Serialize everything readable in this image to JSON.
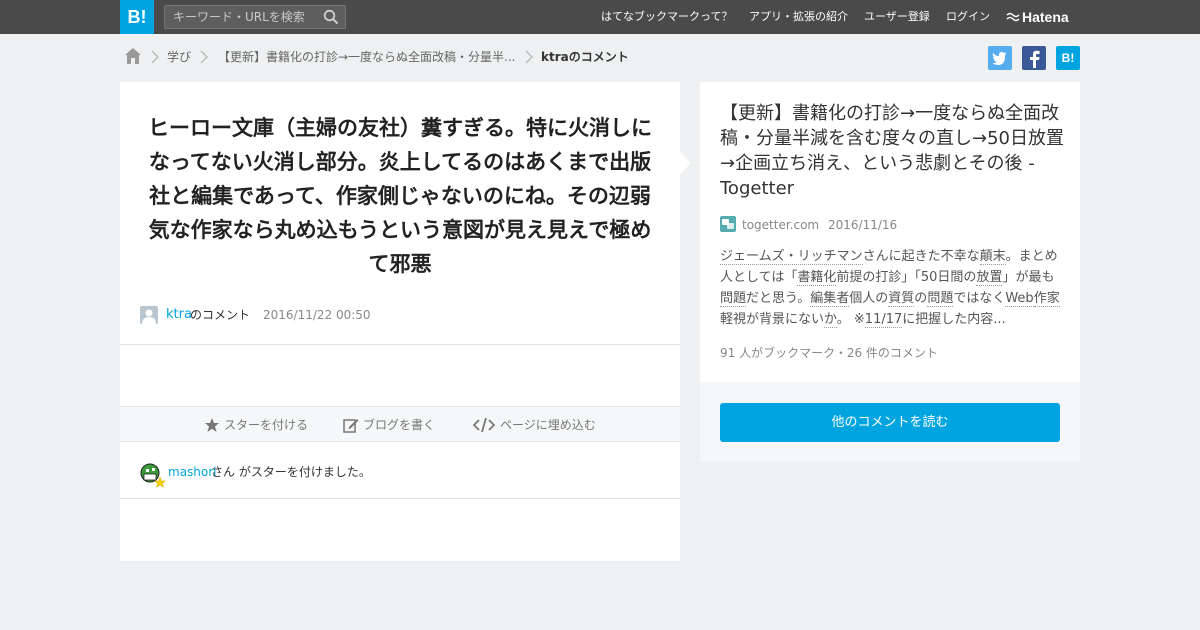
{
  "header": {
    "logo": "B!",
    "search_placeholder": "キーワード・URLを検索",
    "nav": [
      "はてなブックマークって？",
      "アプリ・拡張の紹介",
      "ユーザー登録",
      "ログイン"
    ],
    "brand": "Hatena"
  },
  "breadcrumb": {
    "items": [
      "学び",
      "【更新】書籍化の打診→一度ならぬ全面改稿・分量半...",
      "ktraのコメント"
    ]
  },
  "share": {
    "twitter_icon": "twitter-icon",
    "facebook_icon": "facebook-icon",
    "hatena_label": "B!"
  },
  "comment": {
    "text": "ヒーロー文庫（主婦の友社）糞すぎる。特に火消しになってない火消し部分。炎上してるのはあくまで出版社と編集であって、作家側じゃないのにね。その辺弱気な作家なら丸め込もうという意図が見え見えで極めて邪悪",
    "user": "ktra",
    "user_suffix": "のコメント",
    "date": "2016/11/22 00:50"
  },
  "actions": {
    "star": "スターを付ける",
    "blog": "ブログを書く",
    "embed": "ページに埋め込む"
  },
  "star_notice": {
    "user": "mashori",
    "text": "さん がスターを付けました。"
  },
  "entry": {
    "title": "【更新】書籍化の打診→一度ならぬ全面改稿・分量半減を含む度々の直し→50日放置→企画立ち消え、という悲劇とその後 - Togetter",
    "domain": "togetter.com",
    "date": "2016/11/16",
    "summary_parts": [
      {
        "t": "ジェームズ・リッチマン",
        "kw": true
      },
      {
        "t": "さんに起きた不幸な",
        "kw": false
      },
      {
        "t": "顛末",
        "kw": true
      },
      {
        "t": "。まとめ人としては「",
        "kw": false
      },
      {
        "t": "書籍化",
        "kw": true
      },
      {
        "t": "前提の打診",
        "kw": false
      },
      {
        "t": "」「50日間の",
        "kw": false
      },
      {
        "t": "放置",
        "kw": true
      },
      {
        "t": "」が最も",
        "kw": false
      },
      {
        "t": "問題",
        "kw": true
      },
      {
        "t": "だと思う。",
        "kw": false
      },
      {
        "t": "編集者",
        "kw": true
      },
      {
        "t": "個人の",
        "kw": false
      },
      {
        "t": "資質",
        "kw": true
      },
      {
        "t": "の",
        "kw": false
      },
      {
        "t": "問題",
        "kw": true
      },
      {
        "t": "ではなく",
        "kw": false
      },
      {
        "t": "Web",
        "kw": true
      },
      {
        "t": "作家",
        "kw": true
      },
      {
        "t": "軽視が背景にない",
        "kw": false
      },
      {
        "t": "か",
        "kw": true
      },
      {
        "t": "。 ※",
        "kw": false
      },
      {
        "t": "11/17",
        "kw": true
      },
      {
        "t": "に把握した内容...",
        "kw": false
      }
    ],
    "counts": "91 人がブックマーク・26 件のコメント",
    "more_button": "他のコメントを読む"
  },
  "colors": {
    "header_bg": "#4a4a4a",
    "accent": "#00a4de",
    "twitter": "#55acee",
    "facebook": "#3b5998"
  }
}
